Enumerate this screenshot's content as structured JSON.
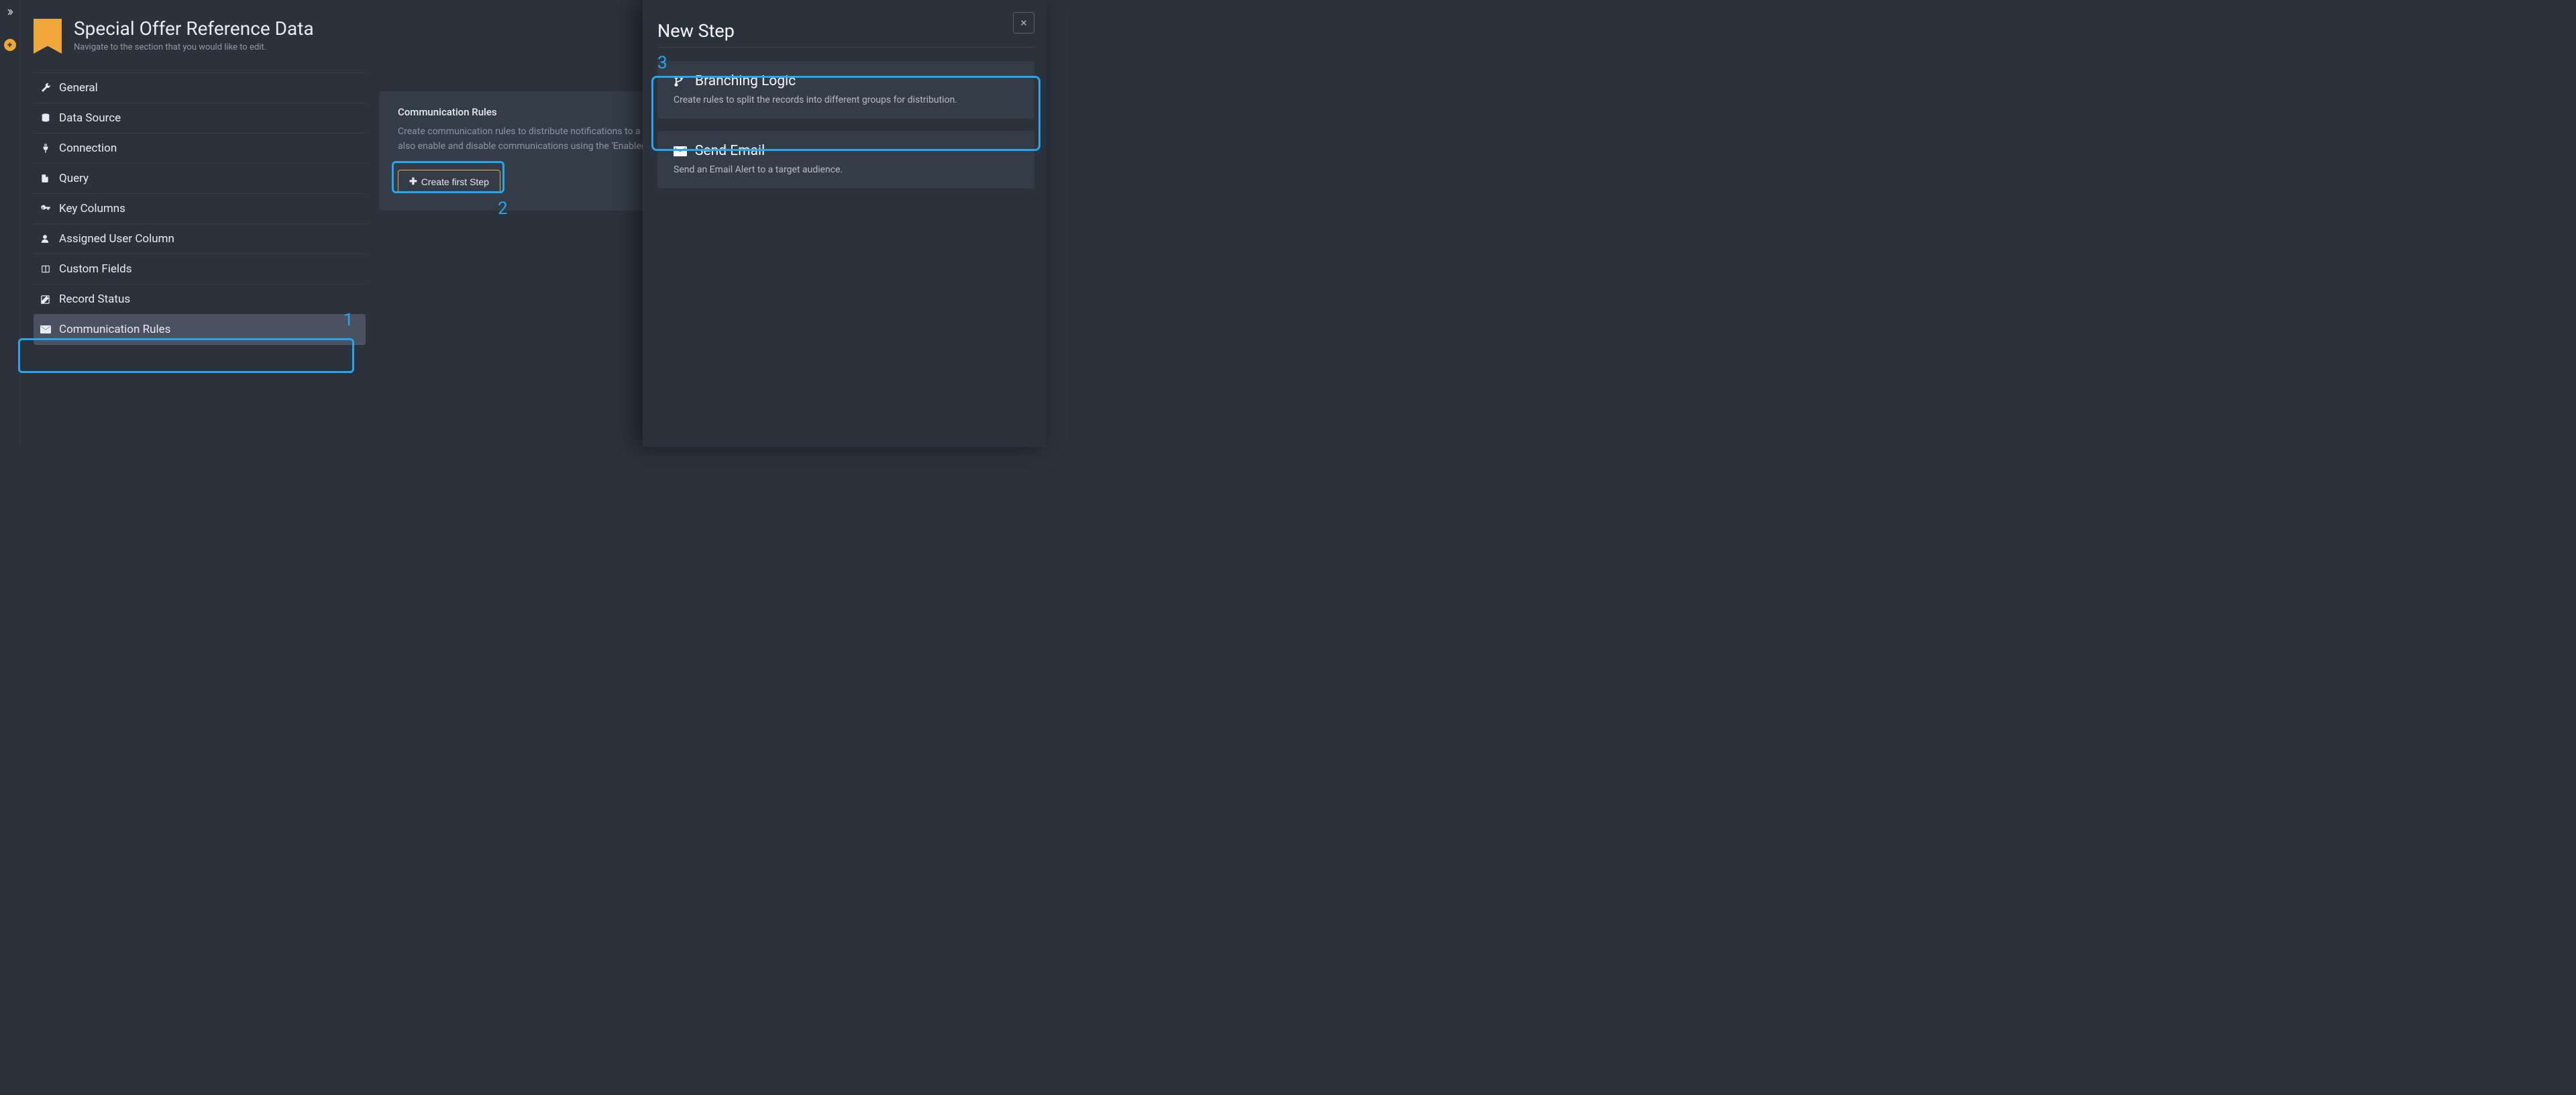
{
  "header": {
    "title": "Special Offer Reference Data",
    "subtitle": "Navigate to the section that you would like to edit."
  },
  "nav": {
    "items": [
      {
        "label": "General"
      },
      {
        "label": "Data Source"
      },
      {
        "label": "Connection"
      },
      {
        "label": "Query"
      },
      {
        "label": "Key Columns"
      },
      {
        "label": "Assigned User Column"
      },
      {
        "label": "Custom Fields"
      },
      {
        "label": "Record Status"
      },
      {
        "label": "Communication Rules"
      }
    ]
  },
  "commRules": {
    "title": "Communication Rules",
    "description": "Create communication rules to distribute notifications to a target audience automatically based on the data in your Reference Data set. You can also enable and disable communications using the 'Enabled' toggle.",
    "createLabel": "Create first Step"
  },
  "callouts": {
    "one": "1",
    "two": "2",
    "three": "3"
  },
  "drawer": {
    "title": "New Step",
    "branching": {
      "title": "Branching Logic",
      "desc": "Create rules to split the records into different groups for distribution."
    },
    "email": {
      "title": "Send Email",
      "desc": "Send an Email Alert to a target audience."
    }
  }
}
